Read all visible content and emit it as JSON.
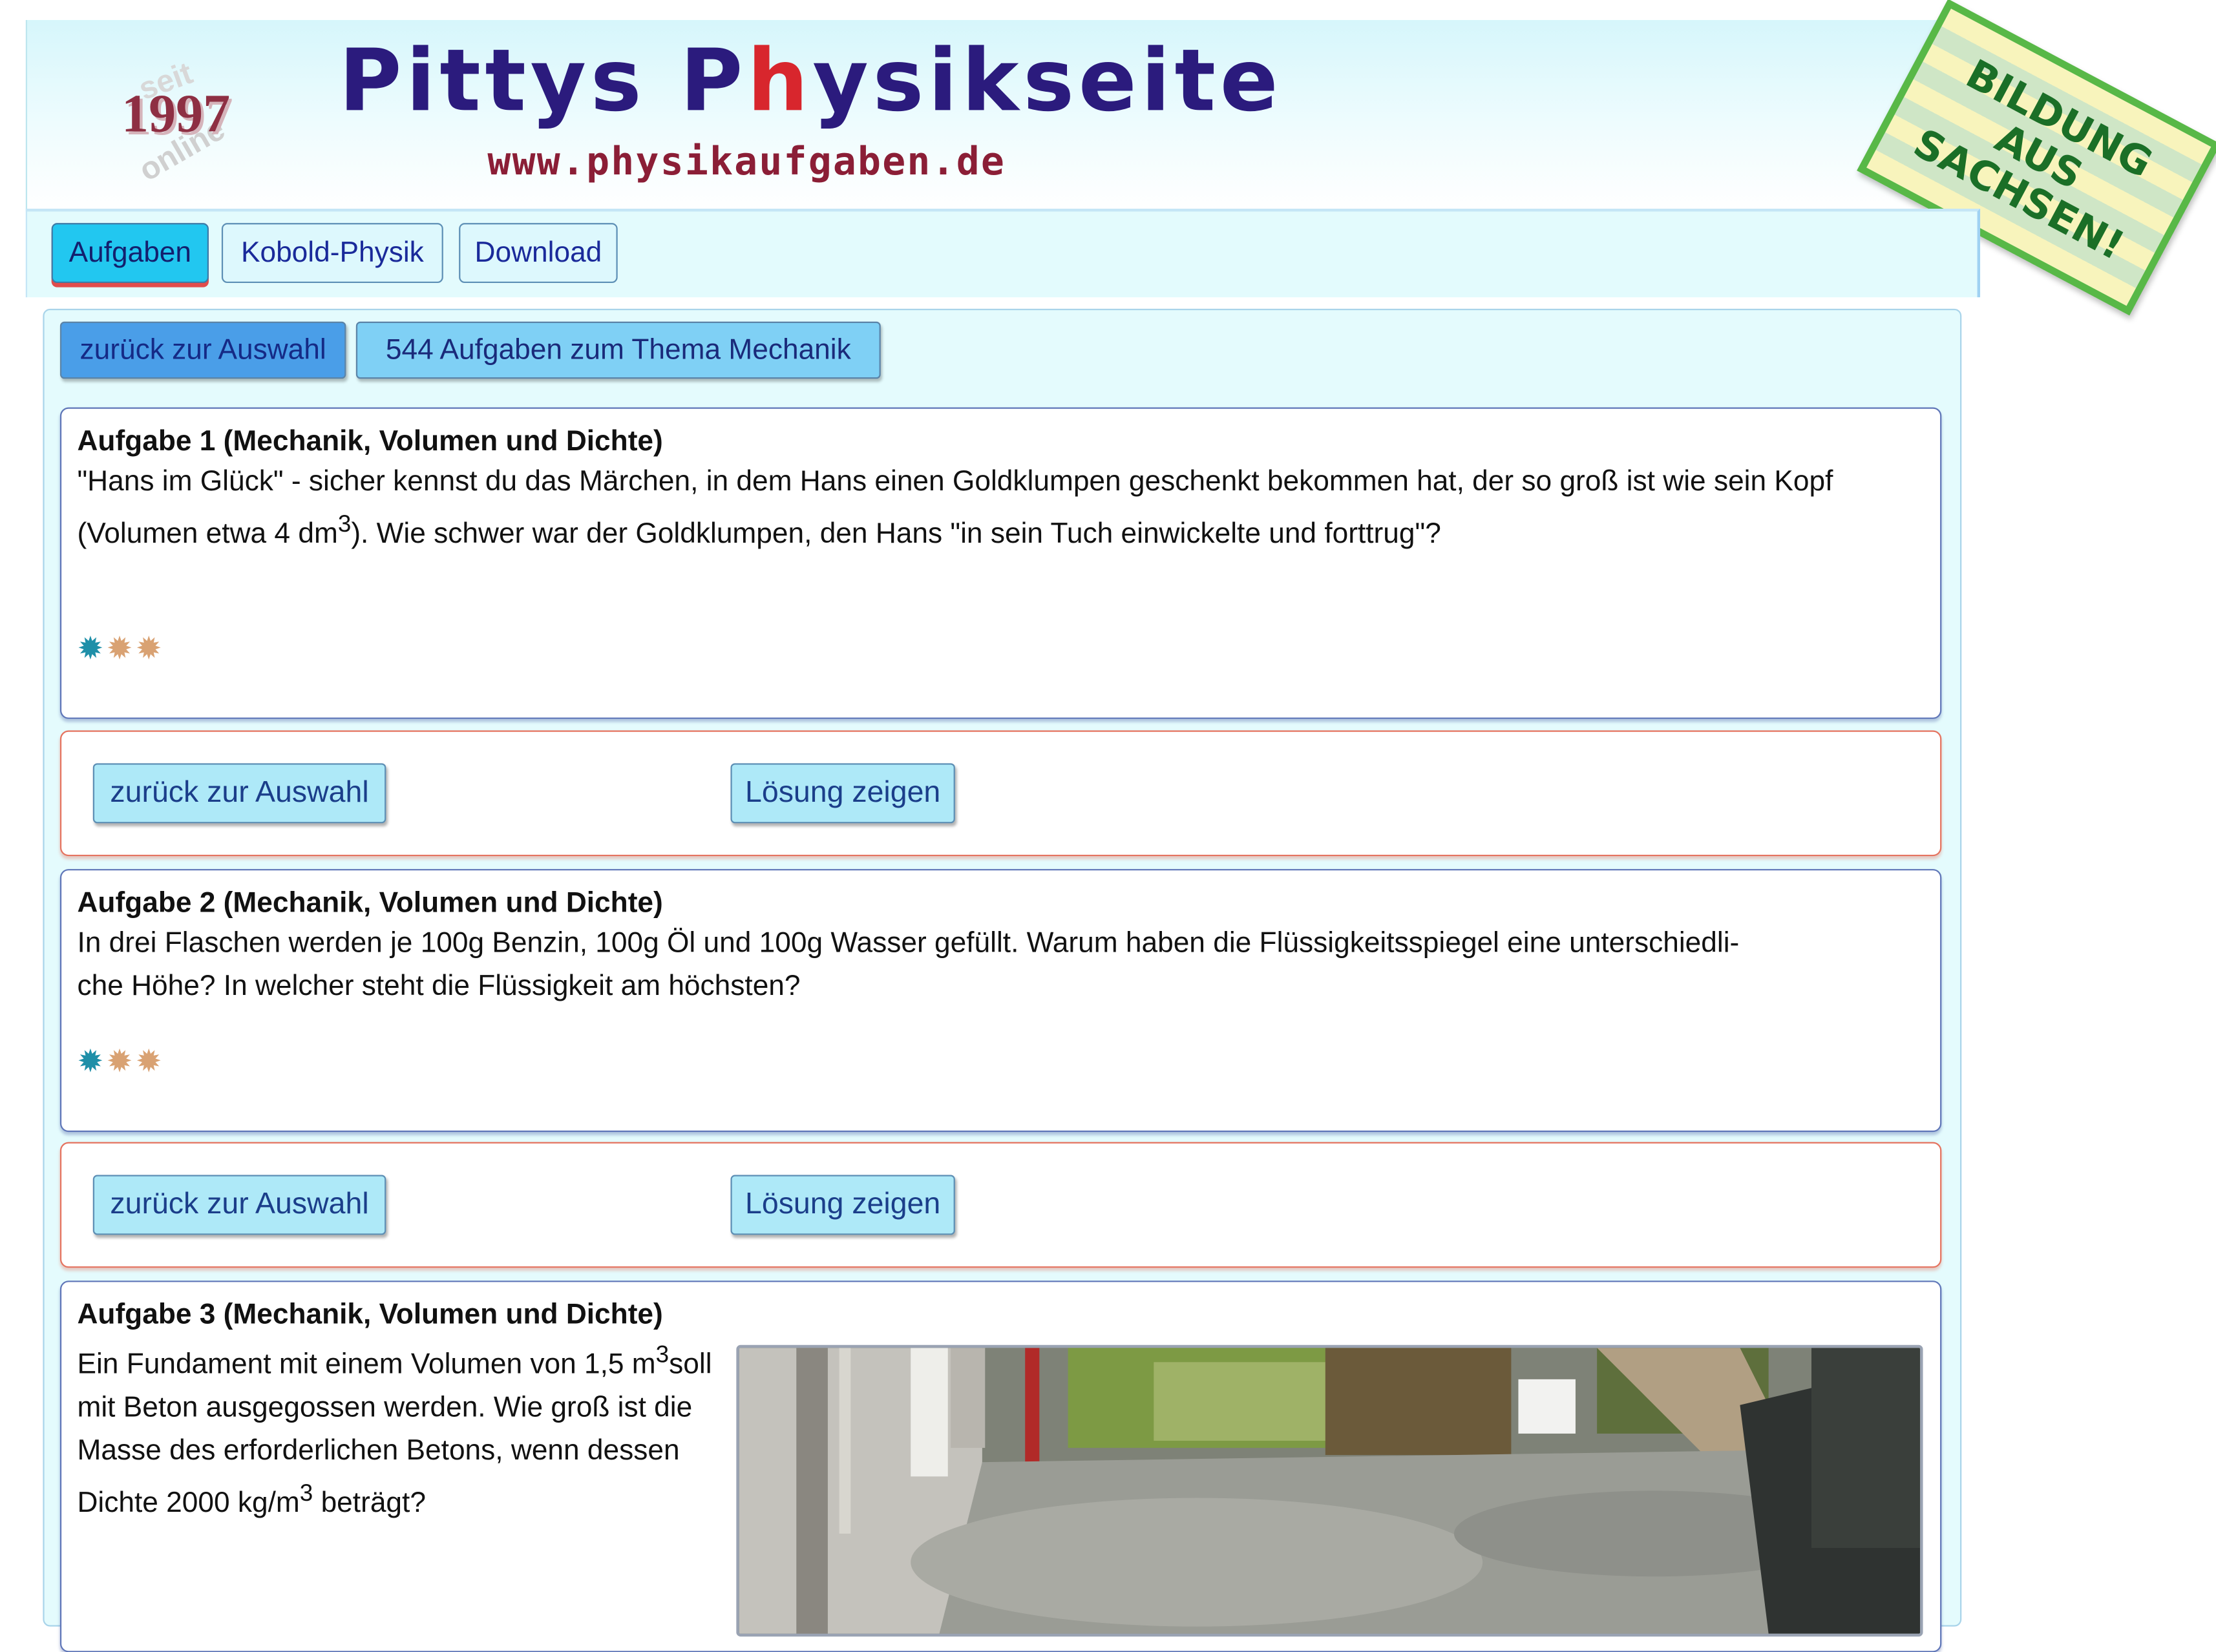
{
  "header": {
    "seit": "seit",
    "online": "online",
    "year": "1997",
    "title_part1": "Pittys P",
    "title_h": "h",
    "title_part2": "ysikseite",
    "url_part1": "www.p",
    "url_h": "h",
    "url_part2": "ysikaufgaben.de"
  },
  "badge": {
    "line1": "BILDUNG",
    "line2": "AUS",
    "line3": "SACHSEN!"
  },
  "nav": {
    "tabs": [
      {
        "label": "Aufgaben",
        "active": true
      },
      {
        "label": "Kobold-Physik"
      },
      {
        "label": "Download"
      }
    ]
  },
  "toolbar": {
    "back": "zurück zur Auswahl",
    "topic": "544 Aufgaben zum Thema Mechanik"
  },
  "tasks": [
    {
      "title": "Aufgabe 1 (Mechanik, Volumen und Dichte)",
      "text_a": "\"Hans im Glück\" - sicher kennst du das Märchen, in dem Hans einen Goldklumpen geschenkt bekommen hat, der so groß ist wie sein Kopf (Volumen etwa 4 dm",
      "sup": "3",
      "text_b": "). Wie schwer war der Goldklumpen, den Hans \"in sein Tuch einwickelte und forttrug\"?",
      "difficulty": 1
    },
    {
      "title": "Aufgabe 2 (Mechanik, Volumen und Dichte)",
      "text_line1": "In drei Flaschen werden je 100g Benzin, 100g Öl und 100g Wasser gefüllt. Warum haben die Flüssigkeitsspiegel eine unterschiedli-",
      "text_line2": "che Höhe? In welcher steht die Flüssigkeit am höchsten?",
      "difficulty": 1
    },
    {
      "title": "Aufgabe 3 (Mechanik, Volumen und Dichte)",
      "text_a": "Ein Fundament mit einem Volumen von 1,5 m",
      "sup1": "3",
      "text_b": "soll mit Beton ausgegossen werden. Wie groß ist die Masse des erforderlichen Betons, wenn dessen Dichte 2000 kg/m",
      "sup2": "3",
      "text_c": " beträgt?"
    }
  ],
  "actions": {
    "back": "zurück zur Auswahl",
    "solution": "Lösung zeigen"
  },
  "stars": {
    "icon": "star-icon",
    "colors": [
      "#1e8fa8",
      "#d9a273",
      "#d9a273"
    ]
  }
}
